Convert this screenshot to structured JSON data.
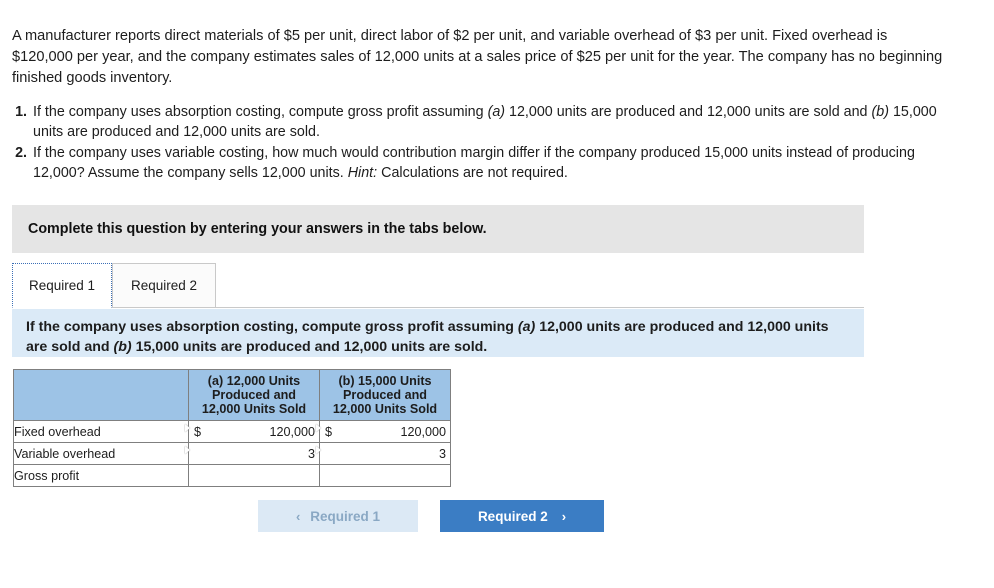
{
  "problem": {
    "statement": "A manufacturer reports direct materials of $5 per unit, direct labor of $2 per unit, and variable overhead of $3 per unit. Fixed overhead is $120,000 per year, and the company estimates sales of 12,000 units at a sales price of $25 per unit for the year. The company has no beginning finished goods inventory."
  },
  "requirements": [
    {
      "number": "1.",
      "lead": "If the company uses absorption costing, compute gross profit assuming ",
      "italic_a": "(a)",
      "mid": " 12,000 units are produced and 12,000 units are sold and ",
      "italic_b": "(b)",
      "tail": " 15,000 units are produced and 12,000 units are sold."
    },
    {
      "number": "2.",
      "lead": "If the company uses variable costing, how much would contribution margin differ if the company produced 15,000 units instead of producing 12,000? Assume the company sells 12,000 units. ",
      "italic_hint": "Hint:",
      "tail": " Calculations are not required."
    }
  ],
  "instruction_bar": {
    "text": "Complete this question by entering your answers in the tabs below."
  },
  "tabs": [
    {
      "label": "Required 1",
      "active": true
    },
    {
      "label": "Required 2",
      "active": false
    }
  ],
  "prompt": {
    "lead": "If the company uses absorption costing, compute gross profit assuming ",
    "italic_a": "(a)",
    "mid": " 12,000 units are produced and 12,000 units are sold and ",
    "italic_b": "(b)",
    "tail": " 15,000 units are produced and 12,000 units are sold."
  },
  "table": {
    "headers": [
      {
        "line1": "",
        "line2": "",
        "line3": ""
      },
      {
        "line1": "(a) 12,000 Units",
        "line2": "Produced and",
        "line3": "12,000 Units Sold"
      },
      {
        "line1": "(b) 15,000 Units",
        "line2": "Produced and",
        "line3": "12,000 Units Sold"
      }
    ],
    "rows": [
      {
        "label": "Fixed overhead",
        "col_a": {
          "symbol": "$",
          "value": "120,000"
        },
        "col_b": {
          "symbol": "$",
          "value": "120,000"
        }
      },
      {
        "label": "Variable overhead",
        "col_a": {
          "symbol": "",
          "value": "3"
        },
        "col_b": {
          "symbol": "",
          "value": "3"
        }
      },
      {
        "label": "Gross profit",
        "col_a": {
          "symbol": "",
          "value": ""
        },
        "col_b": {
          "symbol": "",
          "value": ""
        }
      }
    ]
  },
  "nav": {
    "prev_label": "Required 1",
    "prev_chevron": "‹",
    "next_label": "Required 2",
    "next_chevron": "›"
  },
  "colors": {
    "table_header_blue": "#9dc3e6",
    "prompt_blue": "#dbeaf7",
    "instruction_grey": "#e5e5e5",
    "button_blue": "#3b7dc4",
    "button_disabled": "#dce9f5"
  }
}
